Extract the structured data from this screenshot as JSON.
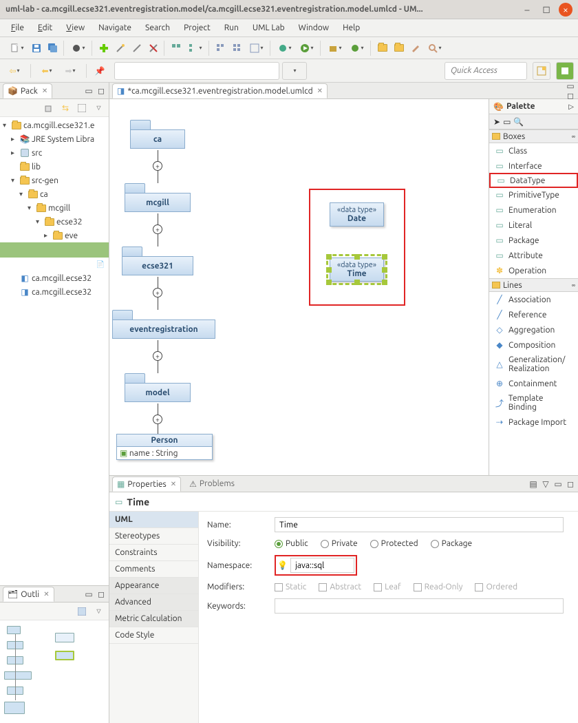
{
  "window": {
    "title": "uml-lab - ca.mcgill.ecse321.eventregistration.model/ca.mcgill.ecse321.eventregistration.model.umlcd - UM..."
  },
  "menu": [
    "File",
    "Edit",
    "View",
    "Navigate",
    "Search",
    "Project",
    "Run",
    "UML Lab",
    "Window",
    "Help"
  ],
  "quick_access_placeholder": "Quick Access",
  "package_view": {
    "tab": "Pack",
    "root": "ca.mcgill.ecse321.e",
    "nodes": {
      "jre": "JRE System Libra",
      "src": "src",
      "lib": "lib",
      "srcgen": "src-gen",
      "ca": "ca",
      "mcgill": "mcgill",
      "ecse32": "ecse32",
      "eve": "eve",
      "file1": "ca.mcgill.ecse32",
      "file2": "ca.mcgill.ecse32"
    }
  },
  "outline": {
    "tab": "Outli"
  },
  "editor": {
    "tab": "*ca.mcgill.ecse321.eventregistration.model.umlcd",
    "packages": [
      "ca",
      "mcgill",
      "ecse321",
      "eventregistration",
      "model"
    ],
    "datatype_label": "«data type»",
    "date": "Date",
    "time": "Time",
    "person_class": {
      "name": "Person",
      "attr": "name : String"
    }
  },
  "palette": {
    "title": "Palette",
    "boxes_title": "Boxes",
    "lines_title": "Lines",
    "boxes": [
      "Class",
      "Interface",
      "DataType",
      "PrimitiveType",
      "Enumeration",
      "Literal",
      "Package",
      "Attribute",
      "Operation"
    ],
    "lines": [
      "Association",
      "Reference",
      "Aggregation",
      "Composition",
      "Generalization/\nRealization",
      "Containment",
      "Template Binding",
      "Package Import"
    ]
  },
  "bottom_tabs": {
    "props": "Properties",
    "problems": "Problems"
  },
  "properties": {
    "element_name": "Time",
    "categories": [
      "UML",
      "Stereotypes",
      "Constraints",
      "Comments",
      "Appearance",
      "Advanced",
      "Metric Calculation",
      "Code Style"
    ],
    "labels": {
      "name": "Name:",
      "visibility": "Visibility:",
      "namespace": "Namespace:",
      "modifiers": "Modifiers:",
      "keywords": "Keywords:"
    },
    "name_value": "Time",
    "namespace_value": "java::sql",
    "visibility": {
      "public": "Public",
      "private": "Private",
      "protected": "Protected",
      "package": "Package"
    },
    "modifiers": {
      "static": "Static",
      "abstract": "Abstract",
      "leaf": "Leaf",
      "readonly": "Read-Only",
      "ordered": "Ordered"
    }
  }
}
